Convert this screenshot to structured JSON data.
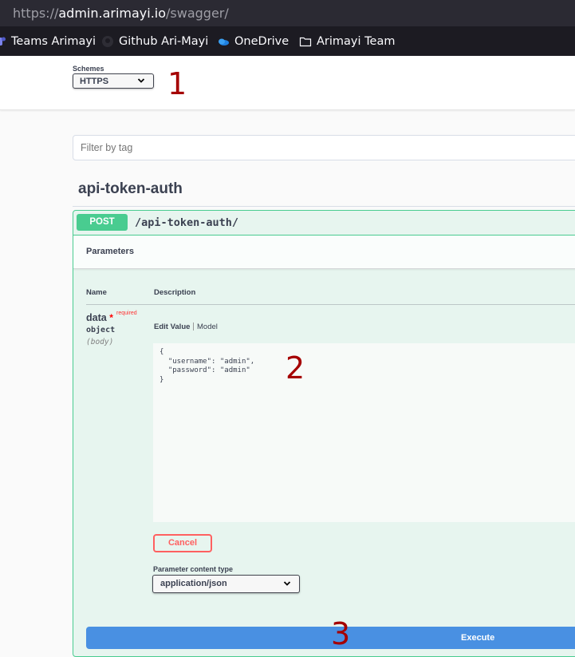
{
  "browser": {
    "url_protocol": "https://",
    "url_host": "admin.arimayi.io",
    "url_path": "/swagger/",
    "bookmarks": [
      {
        "label": "Teams Arimayi",
        "icon": "teams-icon"
      },
      {
        "label": "Github Ari-Mayi",
        "icon": "github-icon"
      },
      {
        "label": "OneDrive",
        "icon": "onedrive-icon"
      },
      {
        "label": "Arimayi Team",
        "icon": "folder-icon"
      }
    ]
  },
  "schemes": {
    "label": "Schemes",
    "selected": "HTTPS"
  },
  "annotations": [
    "1",
    "2",
    "3"
  ],
  "filter": {
    "placeholder": "Filter by tag"
  },
  "tag": {
    "title": "api-token-auth"
  },
  "operation": {
    "method": "POST",
    "path": "/api-token-auth/",
    "parameters_title": "Parameters",
    "columns": {
      "name": "Name",
      "description": "Description"
    },
    "parameter": {
      "name": "data",
      "required_star": "*",
      "required_label": "required",
      "type": "object",
      "in": "(body)"
    },
    "tabs": {
      "edit": "Edit Value",
      "model": "Model"
    },
    "body_value": "{\n  \"username\": \"admin\",\n  \"password\": \"admin\"\n}",
    "cancel_label": "Cancel",
    "content_type_label": "Parameter content type",
    "content_type_selected": "application/json",
    "execute_label": "Execute"
  },
  "colors": {
    "post_green": "#49cc90",
    "execute_blue": "#4990e2",
    "cancel_red": "#ff6060",
    "annotation_red": "#a50000"
  }
}
